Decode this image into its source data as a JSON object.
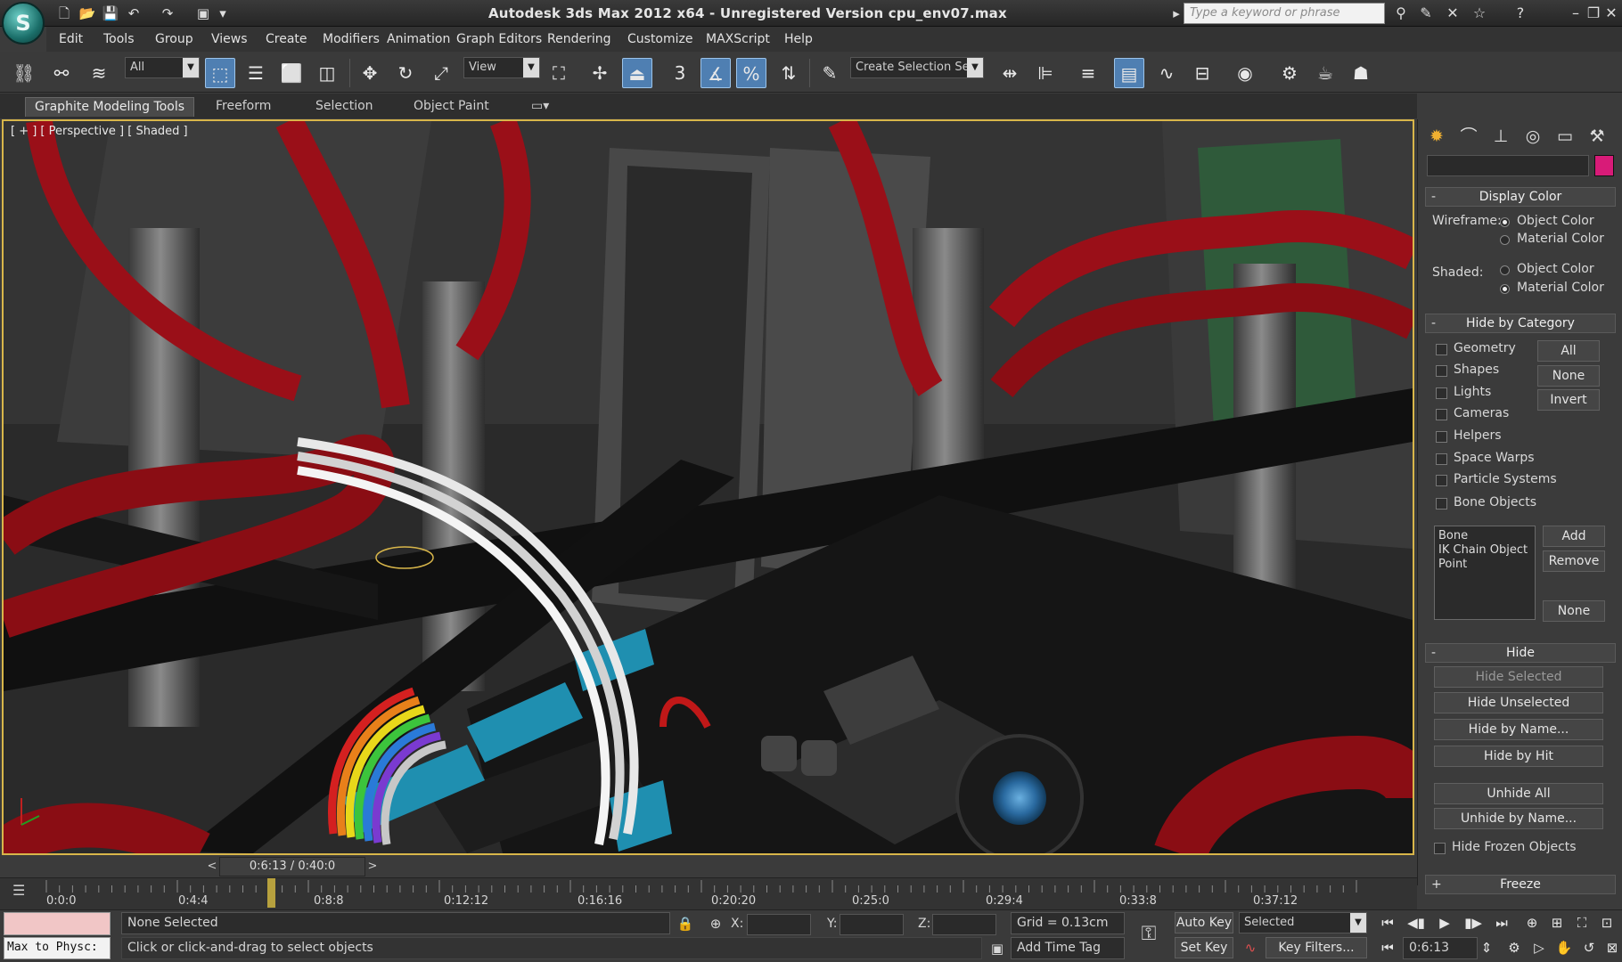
{
  "app": {
    "logo_glyph": "S",
    "title": "Autodesk 3ds Max  2012 x64  -  Unregistered Version   cpu_env07.max",
    "search_placeholder": "Type a keyword or phrase"
  },
  "menu": [
    "Edit",
    "Tools",
    "Group",
    "Views",
    "Create",
    "Modifiers",
    "Animation",
    "Graph Editors",
    "Rendering",
    "Customize",
    "MAXScript",
    "Help"
  ],
  "toolbar": {
    "filter_value": "All",
    "refcoord_value": "View",
    "selection_set_value": "Create Selection Se",
    "snap_label": "3"
  },
  "ribbon": {
    "tabs": [
      "Graphite Modeling Tools",
      "Freeform",
      "Selection",
      "Object Paint"
    ]
  },
  "viewport": {
    "label": "[ + ] [ Perspective ] [ Shaded ]"
  },
  "command_panel": {
    "display_color": {
      "title": "Display Color",
      "wireframe_label": "Wireframe:",
      "shaded_label": "Shaded:",
      "object_color": "Object Color",
      "material_color": "Material Color"
    },
    "hide_by_category": {
      "title": "Hide by Category",
      "categories": [
        "Geometry",
        "Shapes",
        "Lights",
        "Cameras",
        "Helpers",
        "Space Warps",
        "Particle Systems",
        "Bone Objects"
      ],
      "buttons": [
        "All",
        "None",
        "Invert"
      ],
      "list_items": [
        "Bone",
        "IK Chain Object",
        "Point"
      ],
      "list_buttons": [
        "Add",
        "Remove",
        "None"
      ]
    },
    "hide": {
      "title": "Hide",
      "buttons": [
        "Hide Selected",
        "Hide Unselected",
        "Hide by Name...",
        "Hide by Hit",
        "Unhide All",
        "Unhide by Name..."
      ],
      "hide_frozen": "Hide Frozen Objects"
    },
    "freeze": {
      "title": "Freeze"
    }
  },
  "timeline": {
    "current": "0:6:13 / 0:40:0",
    "ticks": [
      "0:0:0",
      "0:4:4",
      "0:8:8",
      "0:12:12",
      "0:16:16",
      "0:20:20",
      "0:25:0",
      "0:29:4",
      "0:33:8",
      "0:37:12"
    ],
    "prev_arrow": "<",
    "next_arrow": ">"
  },
  "status": {
    "maxscript_text": "Max to Physc:",
    "selection_text": "None Selected",
    "prompt_text": "Click or click-and-drag to select objects",
    "x_label": "X:",
    "y_label": "Y:",
    "z_label": "Z:",
    "grid_text": "Grid = 0.13cm",
    "add_time_tag": "Add Time Tag",
    "auto_key": "Auto Key",
    "set_key": "Set Key",
    "key_mode_value": "Selected",
    "key_filters": "Key Filters...",
    "frame_value": "0:6:13"
  },
  "colors": {
    "viewport_border": "#d8b64a",
    "active_tool": "#4f7fb2",
    "object_color_swatch": "#d81b78"
  }
}
